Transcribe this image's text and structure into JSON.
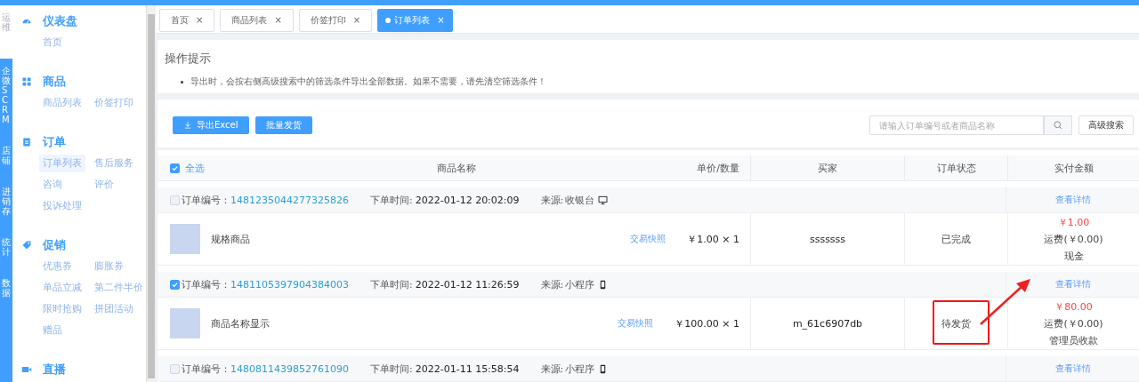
{
  "rail": {
    "items": [
      {
        "label": "运维",
        "selected": true
      },
      {
        "label": "企微SCRM",
        "selected": false
      },
      {
        "label": "店铺",
        "selected": false
      },
      {
        "label": "进销存",
        "selected": false
      },
      {
        "label": "统计",
        "selected": false
      },
      {
        "label": "数据",
        "selected": false
      }
    ]
  },
  "sidebar": {
    "sections": [
      {
        "title": "仪表盘",
        "items": [
          {
            "label": "首页",
            "selected": false
          }
        ]
      },
      {
        "title": "商品",
        "items": [
          {
            "label": "商品列表",
            "selected": false
          },
          {
            "label": "价签打印",
            "selected": false
          }
        ]
      },
      {
        "title": "订单",
        "items": [
          {
            "label": "订单列表",
            "selected": true
          },
          {
            "label": "售后服务",
            "selected": false
          },
          {
            "label": "咨询",
            "selected": false
          },
          {
            "label": "评价",
            "selected": false
          },
          {
            "label": "投诉处理",
            "selected": false
          }
        ]
      },
      {
        "title": "促销",
        "items": [
          {
            "label": "优惠券",
            "selected": false
          },
          {
            "label": "膨胀券",
            "selected": false
          },
          {
            "label": "单品立减",
            "selected": false
          },
          {
            "label": "第二件半价",
            "selected": false
          },
          {
            "label": "限时抢购",
            "selected": false
          },
          {
            "label": "拼团活动",
            "selected": false
          },
          {
            "label": "赠品",
            "selected": false
          }
        ]
      },
      {
        "title": "直播"
      }
    ]
  },
  "tabs": [
    {
      "label": "首页",
      "close": "×",
      "selected": false
    },
    {
      "label": "商品列表",
      "close": "×",
      "selected": false
    },
    {
      "label": "价签打印",
      "close": "×",
      "selected": false
    },
    {
      "label": "订单列表",
      "close": "×",
      "selected": true
    }
  ],
  "tips": {
    "title": "操作提示",
    "lines": [
      "导出时，会按右侧高级搜索中的筛选条件导出全部数据。如果不需要，请先清空筛选条件！"
    ]
  },
  "toolbar": {
    "buttons": [
      {
        "label": "导出Excel"
      },
      {
        "label": "批量发货"
      }
    ],
    "search": {
      "placeholder": "请输入订单编号或者商品名称"
    },
    "advanced": "高级搜索"
  },
  "table": {
    "select_all": {
      "label": "全选",
      "checked": true
    },
    "columns": [
      "商品名称",
      "单价/数量",
      "买家",
      "订单状态",
      "实付金额"
    ],
    "orders": [
      {
        "checked": false,
        "number_label": "订单编号：",
        "number": "1481235044277325826",
        "time_label": "下单时间:",
        "time": "2022-01-12 20:02:09",
        "source_label": "来源:",
        "source": {
          "label": "收银台",
          "kind": "desktop"
        },
        "detail": "查看详情",
        "annotated": false,
        "product": {
          "name": "规格商品",
          "snapshot": "交易快照",
          "price": "￥1.00 × 1"
        },
        "buyer": "sssssss",
        "status": "已完成",
        "amount": "￥1.00",
        "freight": "运费(￥0.00)",
        "payment": "现金"
      },
      {
        "checked": true,
        "number_label": "订单编号：",
        "number": "1481105397904384003",
        "time_label": "下单时间:",
        "time": "2022-01-12 11:26:59",
        "source_label": "来源:",
        "source": {
          "label": "小程序",
          "kind": "mobile"
        },
        "detail": "查看详情",
        "annotated": true,
        "product": {
          "name": "商品名称显示",
          "snapshot": "交易快照",
          "price": "￥100.00 × 1"
        },
        "buyer": "m_61c6907db",
        "status": "待发货",
        "amount": "￥80.00",
        "freight": "运费(￥0.00)",
        "payment": "管理员收款"
      },
      {
        "checked": false,
        "number_label": "订单编号：",
        "number": "1480811439852761090",
        "time_label": "下单时间:",
        "time": "2022-01-11 15:58:54",
        "source_label": "来源:",
        "source": {
          "label": "小程序",
          "kind": "mobile"
        },
        "detail": "查看详情",
        "annotated": false
      }
    ]
  }
}
